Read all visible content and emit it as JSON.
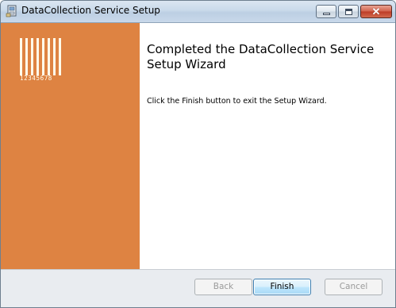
{
  "window": {
    "title": "DataCollection Service Setup",
    "controls": {
      "minimize_icon": "minimize-icon",
      "maximize_icon": "maximize-icon",
      "close_icon": "close-icon",
      "close_glyph": "✕"
    }
  },
  "side_panel": {
    "background_color": "#de8342",
    "logo": {
      "icon": "barcode-icon",
      "digits": "12345678"
    }
  },
  "main": {
    "heading": "Completed the DataCollection Service Setup Wizard",
    "info": "Click the Finish button to exit the Setup Wizard."
  },
  "footer": {
    "back_label": "Back",
    "finish_label": "Finish",
    "cancel_label": "Cancel"
  }
}
